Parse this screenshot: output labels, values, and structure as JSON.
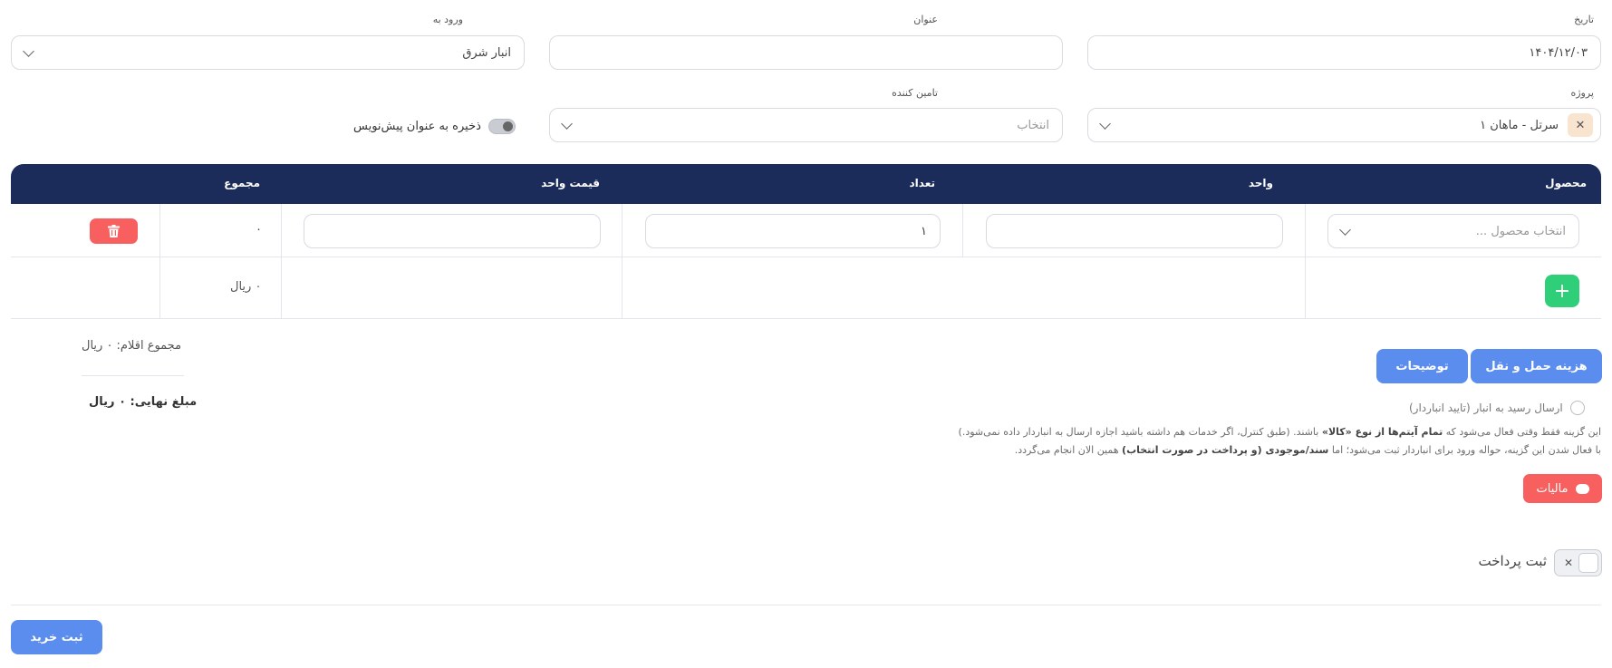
{
  "form": {
    "date_label": "تاریخ",
    "date_value": "۱۴۰۴/۱۲/۰۳",
    "title_label": "عنوان",
    "title_value": "",
    "entry_label": "ورود به",
    "entry_value": "انبار شرق",
    "project_label": "پروژه",
    "project_value": "سرتل - ماهان ۱",
    "supplier_label": "تامین کننده",
    "supplier_placeholder": "انتخاب",
    "draft_label": "ذخیره به عنوان پیش‌نویس"
  },
  "table": {
    "headers": {
      "product": "محصول",
      "unit": "واحد",
      "quantity": "تعداد",
      "unit_price": "قیمت واحد",
      "total": "مجموع"
    },
    "rows": [
      {
        "product_placeholder": "انتخاب محصول ...",
        "unit": "",
        "quantity": "۱",
        "unit_price": "",
        "total": "۰"
      }
    ],
    "footer_total": "۰ ریال"
  },
  "summary": {
    "items_total": "مجموع اقلام: ۰ ریال",
    "final_amount": "مبلغ نهایی: ۰ ریال"
  },
  "buttons": {
    "shipping": "هزینه حمل و نقل",
    "description": "توضیحات",
    "tax": "مالیات",
    "submit": "ثبت خرید"
  },
  "receipt": {
    "label": "ارسال رسید به انبار (تایید انباردار)",
    "note1_pre": "این گزینه فقط وقتی فعال می‌شود که ",
    "note1_bold": "تمام آیتم‌ها از نوع «کالا»",
    "note1_post": " باشند. (طبق کنترل، اگر خدمات هم داشته باشید اجازه ارسال به انباردار داده نمی‌شود.)",
    "note2_pre": "با فعال شدن این گزینه، حواله ورود برای انباردار ثبت می‌شود؛ اما ",
    "note2_bold": "سند/موجودی (و پرداخت در صورت انتخاب)",
    "note2_post": " همین الان انجام می‌گردد."
  },
  "payment": {
    "label": "ثبت پرداخت"
  },
  "colors": {
    "navy": "#1b2b5a",
    "blue": "#5b8def",
    "red": "#f85f5f",
    "green": "#2fcf7a"
  }
}
